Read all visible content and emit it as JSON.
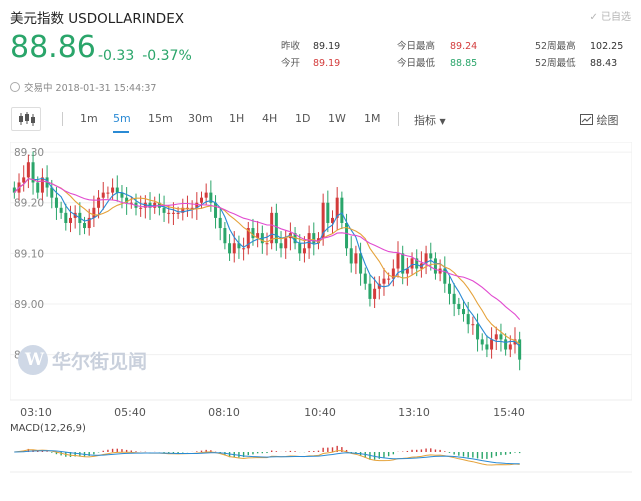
{
  "header": {
    "title": "美元指数  USDOLLARINDEX",
    "added_label": "已自选",
    "price": "88.86",
    "change": "-0.33",
    "change_pct": "-0.37%",
    "trade_status": "交易中 2018-01-31 15:44:37",
    "stats": [
      {
        "label": "昨收",
        "value": "89.19",
        "tone": "dark"
      },
      {
        "label": "今开",
        "value": "89.19",
        "tone": "red"
      },
      {
        "label": "今日最高",
        "value": "89.24",
        "tone": "red"
      },
      {
        "label": "今日最低",
        "value": "88.85",
        "tone": "green"
      },
      {
        "label": "52周最高",
        "value": "102.25",
        "tone": "dark"
      },
      {
        "label": "52周最低",
        "value": "88.43",
        "tone": "dark"
      }
    ]
  },
  "toolbar": {
    "periods": [
      "1m",
      "5m",
      "15m",
      "30m",
      "1H",
      "4H",
      "1D",
      "1W",
      "1M"
    ],
    "active_period": "5m",
    "indicator_label": "指标",
    "draw_label": "绘图"
  },
  "watermark": {
    "text": "华尔街见闻"
  },
  "colors": {
    "up": "#d33b3b",
    "down": "#2aa56a",
    "accent": "#2a8ad4",
    "ma_fast": "#2a8ad4",
    "ma_mid": "#e5a23a",
    "ma_slow": "#e14bd0"
  },
  "chart_data": {
    "type": "candlestick",
    "y_ticks": [
      "89.30",
      "89.20",
      "89.10",
      "89.00",
      "88.90"
    ],
    "ylim": [
      88.83,
      89.32
    ],
    "x_ticks": [
      "03:10",
      "05:40",
      "08:10",
      "10:40",
      "13:10",
      "15:40"
    ],
    "close_series": [
      89.22,
      89.24,
      89.25,
      89.28,
      89.24,
      89.22,
      89.25,
      89.23,
      89.21,
      89.19,
      89.18,
      89.16,
      89.17,
      89.18,
      89.16,
      89.15,
      89.17,
      89.19,
      89.21,
      89.22,
      89.22,
      89.23,
      89.22,
      89.21,
      89.2,
      89.2,
      89.19,
      89.19,
      89.2,
      89.19,
      89.2,
      89.19,
      89.18,
      89.18,
      89.18,
      89.18,
      89.19,
      89.19,
      89.19,
      89.2,
      89.21,
      89.22,
      89.2,
      89.17,
      89.15,
      89.12,
      89.1,
      89.12,
      89.11,
      89.11,
      89.15,
      89.13,
      89.14,
      89.12,
      89.12,
      89.18,
      89.12,
      89.11,
      89.13,
      89.14,
      89.12,
      89.1,
      89.11,
      89.14,
      89.12,
      89.13,
      89.2,
      89.16,
      89.17,
      89.21,
      89.16,
      89.11,
      89.08,
      89.1,
      89.06,
      89.04,
      89.01,
      89.03,
      89.04,
      89.05,
      89.05,
      89.07,
      89.1,
      89.06,
      89.07,
      89.09,
      89.07,
      89.08,
      89.1,
      89.09,
      89.06,
      89.07,
      89.04,
      89.02,
      89.0,
      88.99,
      88.98,
      88.96,
      88.96,
      88.93,
      88.92,
      88.91,
      88.93,
      88.94,
      88.93,
      88.91,
      88.92,
      88.93,
      88.89
    ],
    "macd_label": "MACD(12,26,9)"
  }
}
